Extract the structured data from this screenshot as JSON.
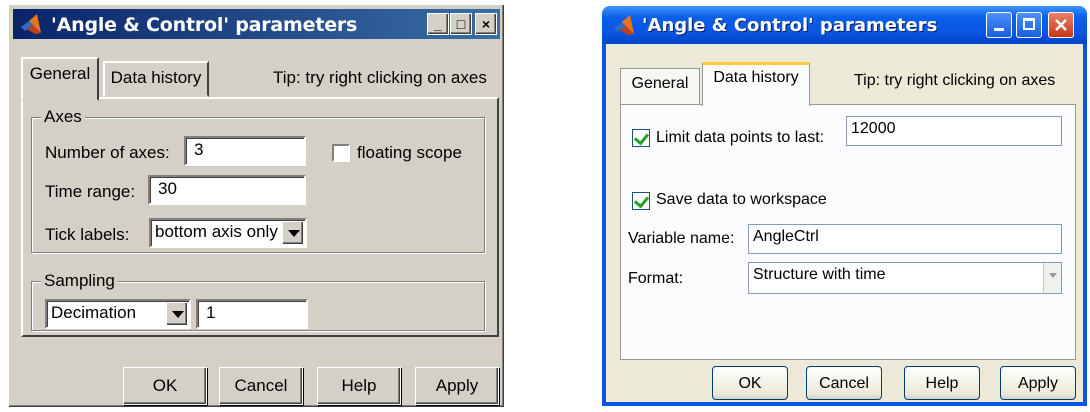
{
  "dialog1": {
    "title": "'Angle & Control' parameters",
    "titlebar_buttons": {
      "minimize": "_",
      "maximize": "□",
      "close": "×"
    },
    "tabs": [
      "General",
      "Data history"
    ],
    "active_tab": "General",
    "tip": "Tip: try right clicking on axes",
    "axes_group": {
      "legend": "Axes",
      "number_of_axes_label": "Number of axes:",
      "number_of_axes_value": "3",
      "floating_scope_label": "floating scope",
      "floating_scope_checked": false,
      "time_range_label": "Time range:",
      "time_range_value": "30",
      "tick_labels_label": "Tick labels:",
      "tick_labels_value": "bottom axis only"
    },
    "sampling_group": {
      "legend": "Sampling",
      "method_value": "Decimation",
      "factor_value": "1"
    },
    "buttons": {
      "ok": "OK",
      "cancel": "Cancel",
      "help": "Help",
      "apply": "Apply"
    }
  },
  "dialog2": {
    "title": "'Angle & Control' parameters",
    "tabs": [
      "General",
      "Data history"
    ],
    "active_tab": "Data history",
    "tip": "Tip: try right clicking on axes",
    "limit_points_label": "Limit data points to last:",
    "limit_points_checked": true,
    "limit_points_value": "12000",
    "save_workspace_label": "Save data to workspace",
    "save_workspace_checked": true,
    "variable_name_label": "Variable name:",
    "variable_name_value": "AngleCtrl",
    "format_label": "Format:",
    "format_value": "Structure with time",
    "buttons": {
      "ok": "OK",
      "cancel": "Cancel",
      "help": "Help",
      "apply": "Apply"
    }
  },
  "colors": {
    "classic_titlebar": "#0a246a",
    "xp_titlebar": "#0a55e2",
    "classic_face": "#d4d0c8",
    "xp_face": "#ece9d8"
  }
}
